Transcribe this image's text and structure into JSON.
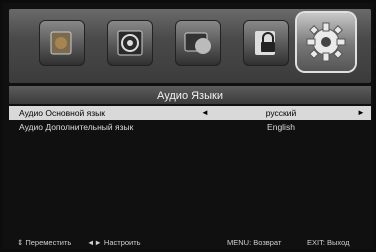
{
  "menu": {
    "icons": [
      "picture-icon",
      "sound-icon",
      "channel-icon",
      "lock-icon",
      "setup-gear-icon"
    ],
    "active_index": 4
  },
  "title": "Аудио Языки",
  "rows": [
    {
      "label": "Аудио Основной язык",
      "value": "русский",
      "left_arrow": "◄",
      "right_arrow": "►",
      "selected": true
    },
    {
      "label": "Аудио Дополнительный язык",
      "value": "English",
      "selected": false
    }
  ],
  "hints": {
    "move": "⇕ Переместить",
    "adjust": "◄► Настроить",
    "back": "MENU: Возврат",
    "exit": "EXIT: Выход"
  },
  "colors": {
    "selected_row_bg": "#d9d9d9",
    "background": "#101010"
  }
}
